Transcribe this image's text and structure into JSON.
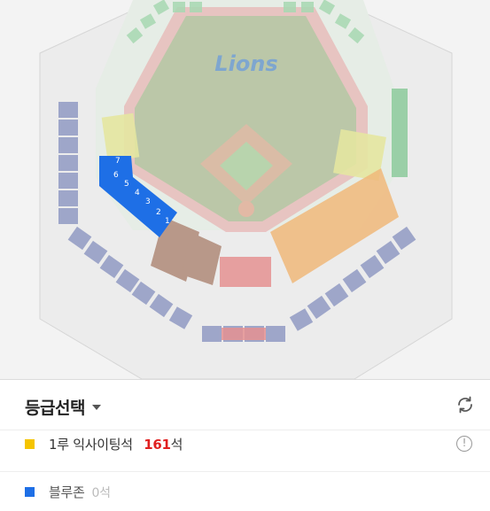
{
  "map": {
    "logo": "Lions",
    "brand_color": "#2a6fc4",
    "selected_section_color": "#1e6fe6",
    "selected_seats": [
      "7",
      "6",
      "5",
      "4",
      "3",
      "2",
      "1"
    ],
    "selected_seat_color": "#1e6fe6"
  },
  "panel": {
    "title": "등급선택",
    "grades": [
      {
        "swatch_color": "#f5c400",
        "name": "1루 익사이팅석",
        "count": "161",
        "unit": "석"
      },
      {
        "swatch_color": "#1e6fe6",
        "name": "블루존",
        "count": "0석"
      }
    ]
  }
}
